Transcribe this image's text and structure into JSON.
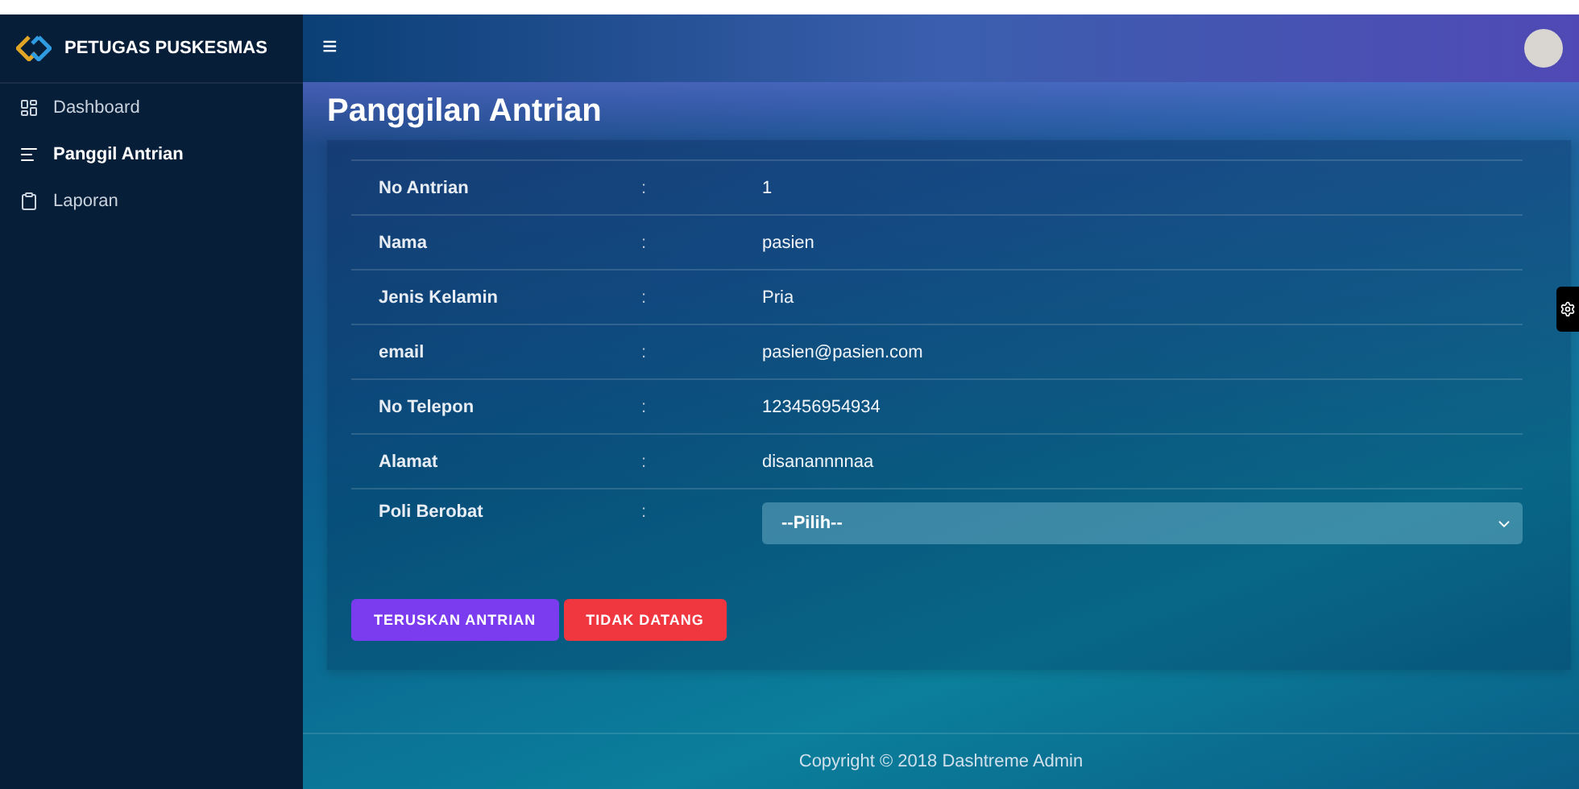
{
  "brand": {
    "title": "PETUGAS PUSKESMAS"
  },
  "sidebar": {
    "items": [
      {
        "label": "Dashboard",
        "selected": false
      },
      {
        "label": "Panggil Antrian",
        "selected": true
      },
      {
        "label": "Laporan",
        "selected": false
      }
    ]
  },
  "topbar": {
    "menu_icon": "≡"
  },
  "page_title": "Panggilan Antrian",
  "details": [
    {
      "label": "No Antrian",
      "separator": ":",
      "value": "1"
    },
    {
      "label": "Nama",
      "separator": ":",
      "value": "pasien"
    },
    {
      "label": "Jenis Kelamin",
      "separator": ":",
      "value": "Pria"
    },
    {
      "label": "email",
      "separator": ":",
      "value": "pasien@pasien.com"
    },
    {
      "label": "No Telepon",
      "separator": ":",
      "value": "123456954934"
    },
    {
      "label": "Alamat",
      "separator": ":",
      "value": "disanannnnaa"
    }
  ],
  "poli": {
    "label": "Poli Berobat",
    "separator": ":",
    "value": "--Pilih--"
  },
  "buttons": [
    {
      "label": "TERUSKAN ANTRIAN",
      "kind": "primary"
    },
    {
      "label": "TIDAK DATANG",
      "kind": "danger"
    }
  ],
  "footer": "Copyright © 2018 Dashtreme Admin"
}
